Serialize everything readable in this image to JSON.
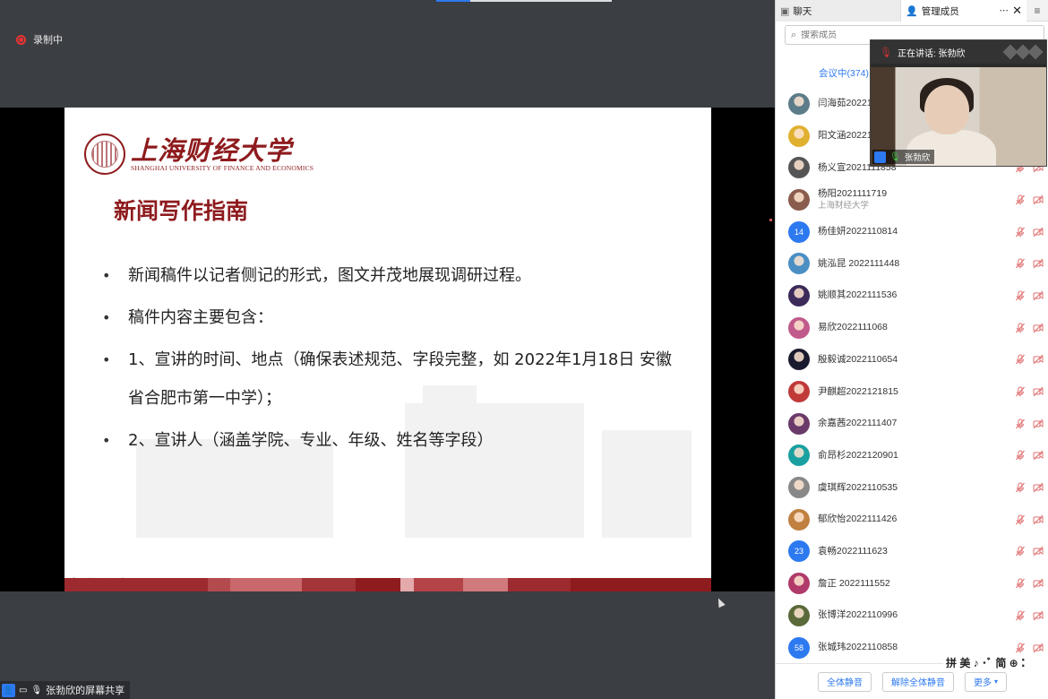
{
  "recording": {
    "label": "录制中"
  },
  "slide": {
    "logo_cn": "上海财经大学",
    "logo_en": "SHANGHAI UNIVERSITY OF FINANCE AND ECONOMICS",
    "title": "新闻写作指南",
    "bullets": [
      "新闻稿件以记者侧记的形式，图文并茂地展现调研过程。",
      "稿件内容主要包含：",
      "1、宣讲的时间、地点（确保表述规范、字段完整，如 2022年1月18日  安徽省合肥市第一中学）；",
      "2、宣讲人（涵盖学院、专业、年级、姓名等字段）"
    ]
  },
  "share_label": {
    "text": "张勃欣的屏幕共享"
  },
  "panel": {
    "tab_chat": "聊天",
    "tab_members": "管理成员",
    "search_placeholder": "搜索成员",
    "meeting_tab": "会议中(374)",
    "members": [
      {
        "name": "闫海茹20221",
        "sub": "",
        "avatar": "photo",
        "color": "#5c7c8a"
      },
      {
        "name": "阳文涵20221",
        "sub": "",
        "avatar": "photo",
        "color": "#e0b030"
      },
      {
        "name": "杨义宣2021111858",
        "sub": "",
        "avatar": "photo",
        "color": "#555555"
      },
      {
        "name": "杨阳2021111719",
        "sub": "上海财经大学",
        "avatar": "photo",
        "color": "#8a5c4e"
      },
      {
        "name": "杨佳妍2022110814",
        "sub": "",
        "avatar": "14",
        "color": "#2d79f0"
      },
      {
        "name": "姚泓昆 2022111448",
        "sub": "",
        "avatar": "photo",
        "color": "#4a8fc4"
      },
      {
        "name": "姚顺其2022111536",
        "sub": "",
        "avatar": "photo",
        "color": "#3b2a5a"
      },
      {
        "name": "易欣2022111068",
        "sub": "",
        "avatar": "photo",
        "color": "#c05a8a"
      },
      {
        "name": "殷毅诚2022110654",
        "sub": "",
        "avatar": "photo",
        "color": "#1a1a2e"
      },
      {
        "name": "尹麒超2022121815",
        "sub": "",
        "avatar": "photo",
        "color": "#c03a3a"
      },
      {
        "name": "余嘉茜2022111407",
        "sub": "",
        "avatar": "photo",
        "color": "#6a3a6a"
      },
      {
        "name": "俞昂杉2022120901",
        "sub": "",
        "avatar": "photo",
        "color": "#1aa0a0"
      },
      {
        "name": "虞琪辉2022110535",
        "sub": "",
        "avatar": "photo",
        "color": "#888888"
      },
      {
        "name": "郁欣怡2022111426",
        "sub": "",
        "avatar": "photo",
        "color": "#c08040"
      },
      {
        "name": "袁畅2022111623",
        "sub": "",
        "avatar": "23",
        "color": "#2d79f0"
      },
      {
        "name": "詹正 2022111552",
        "sub": "",
        "avatar": "photo",
        "color": "#b03a6a"
      },
      {
        "name": "张博洋2022110996",
        "sub": "",
        "avatar": "photo",
        "color": "#5a6a3a"
      },
      {
        "name": "张城玮2022110858",
        "sub": "",
        "avatar": "58",
        "color": "#2d79f0"
      }
    ],
    "buttons": {
      "mute_all": "全体静音",
      "unmute_all": "解除全体静音",
      "more": "更多"
    }
  },
  "video": {
    "speaking_label": "正在讲话: 张勃欣",
    "name_label": "张勃欣"
  },
  "ime": {
    "text": "拼 美 ♪ ･ﾞ 简 ⊕ ⁚"
  }
}
